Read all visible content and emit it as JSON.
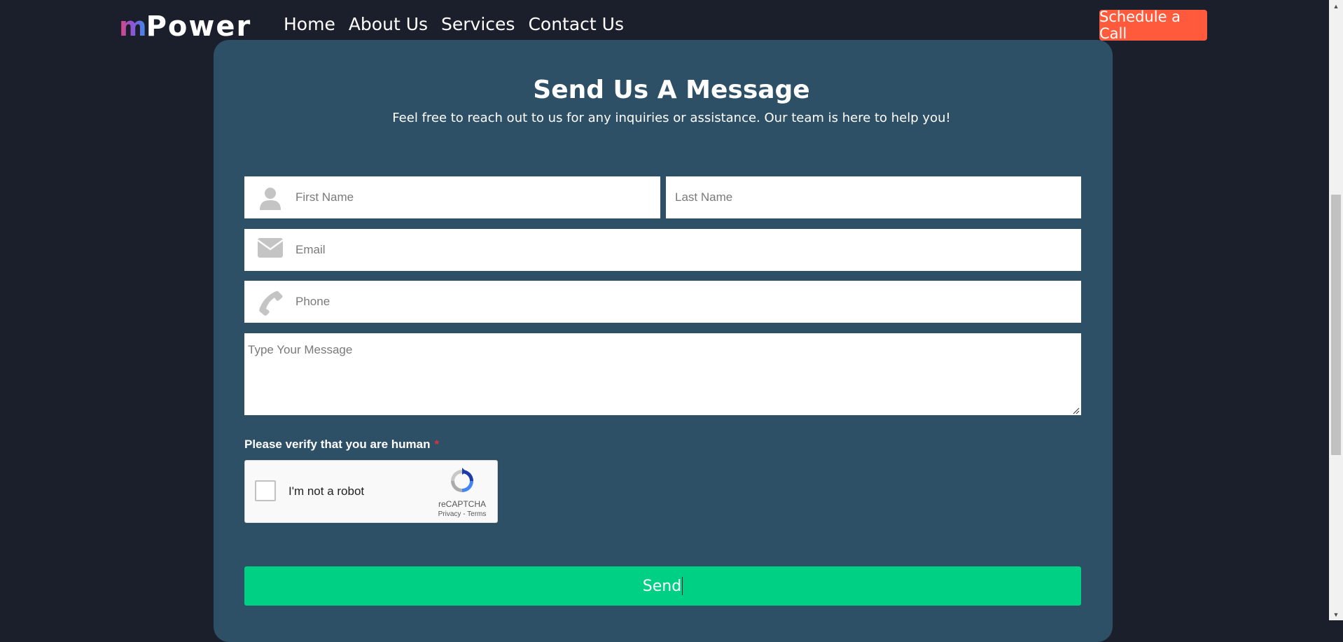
{
  "header": {
    "logo": {
      "m": "m",
      "rest": "Power"
    },
    "nav": [
      "Home",
      "About Us",
      "Services",
      "Contact Us"
    ],
    "cta": "Schedule a Call"
  },
  "form": {
    "title": "Send Us A Message",
    "subtitle": "Feel free to reach out to us for any inquiries or assistance. Our team is here to help you!",
    "first_name_placeholder": "First Name",
    "last_name_placeholder": "Last Name",
    "email_placeholder": "Email",
    "phone_placeholder": "Phone",
    "message_placeholder": "Type Your Message",
    "verify_label": "Please verify that you are human",
    "required_mark": "*",
    "captcha": {
      "label": "I'm not a robot",
      "brand": "reCAPTCHA",
      "privacy": "Privacy",
      "separator": "-",
      "terms": "Terms"
    },
    "send_label": "Send"
  },
  "colors": {
    "background": "#1b1f2b",
    "card": "#2d5066",
    "cta": "#ff5a3c",
    "send": "#00d084"
  }
}
